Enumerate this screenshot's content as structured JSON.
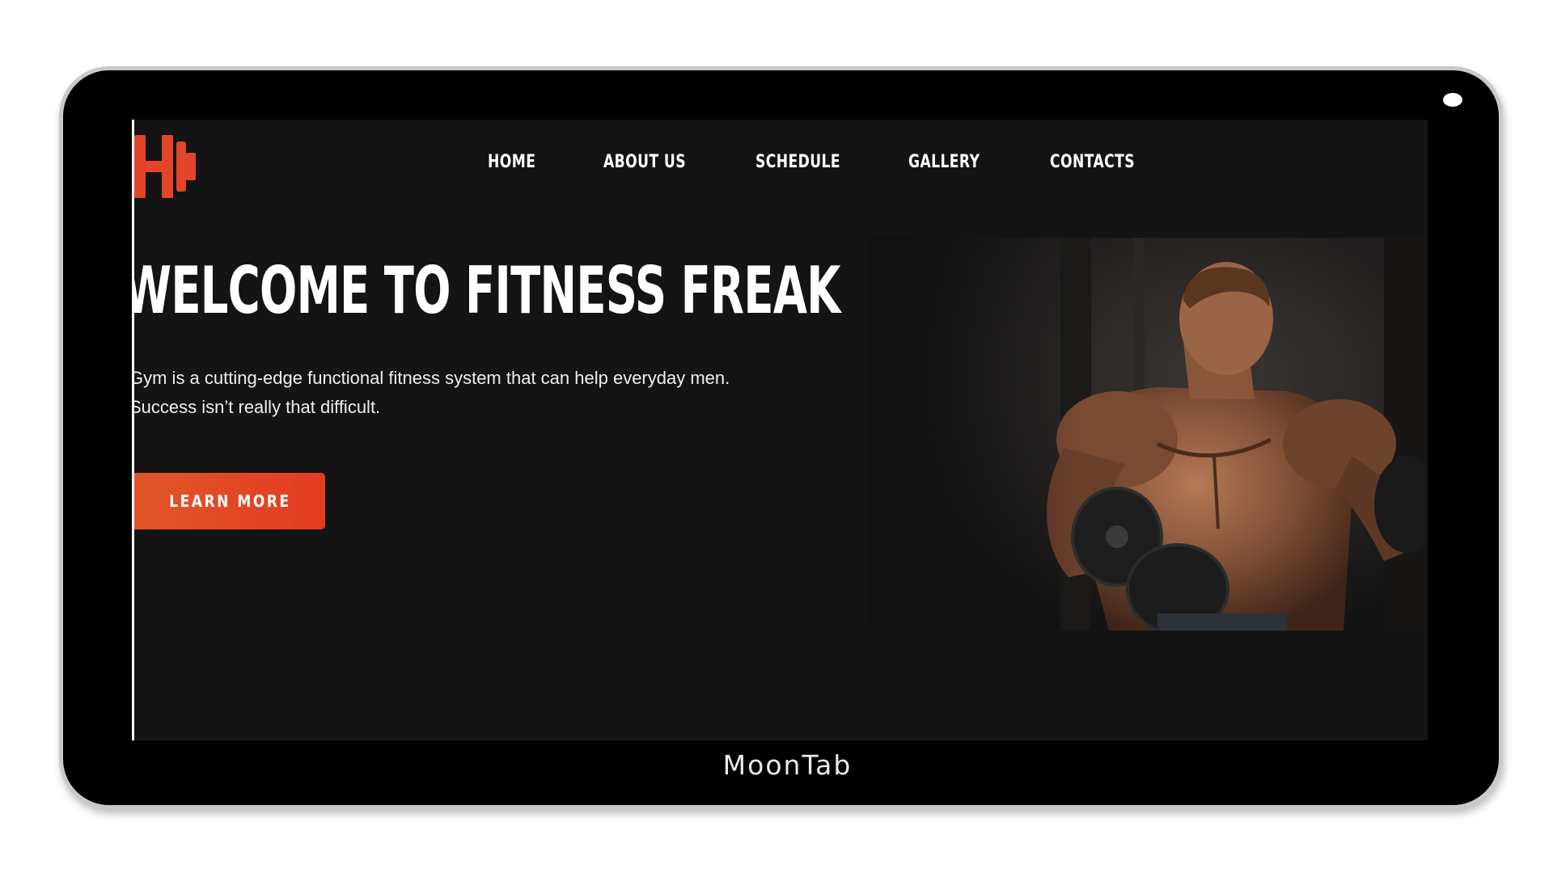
{
  "device": {
    "brand_label": "MoonTab"
  },
  "site": {
    "logo_icon": "dumbbell-h-logo-icon",
    "accent_color": "#e2452a",
    "nav": [
      {
        "label": "HOME"
      },
      {
        "label": "ABOUT US"
      },
      {
        "label": "SCHEDULE"
      },
      {
        "label": "GALLERY"
      },
      {
        "label": "CONTACTS"
      }
    ],
    "hero": {
      "title": "WELCOME TO FITNESS FREAK",
      "line1": "Gym is a cutting-edge functional fitness system that can help everyday men.",
      "line2": "Success isn’t really that difficult.",
      "cta_label": "LEARN MORE",
      "image_icon": "bodybuilder-photo"
    }
  }
}
